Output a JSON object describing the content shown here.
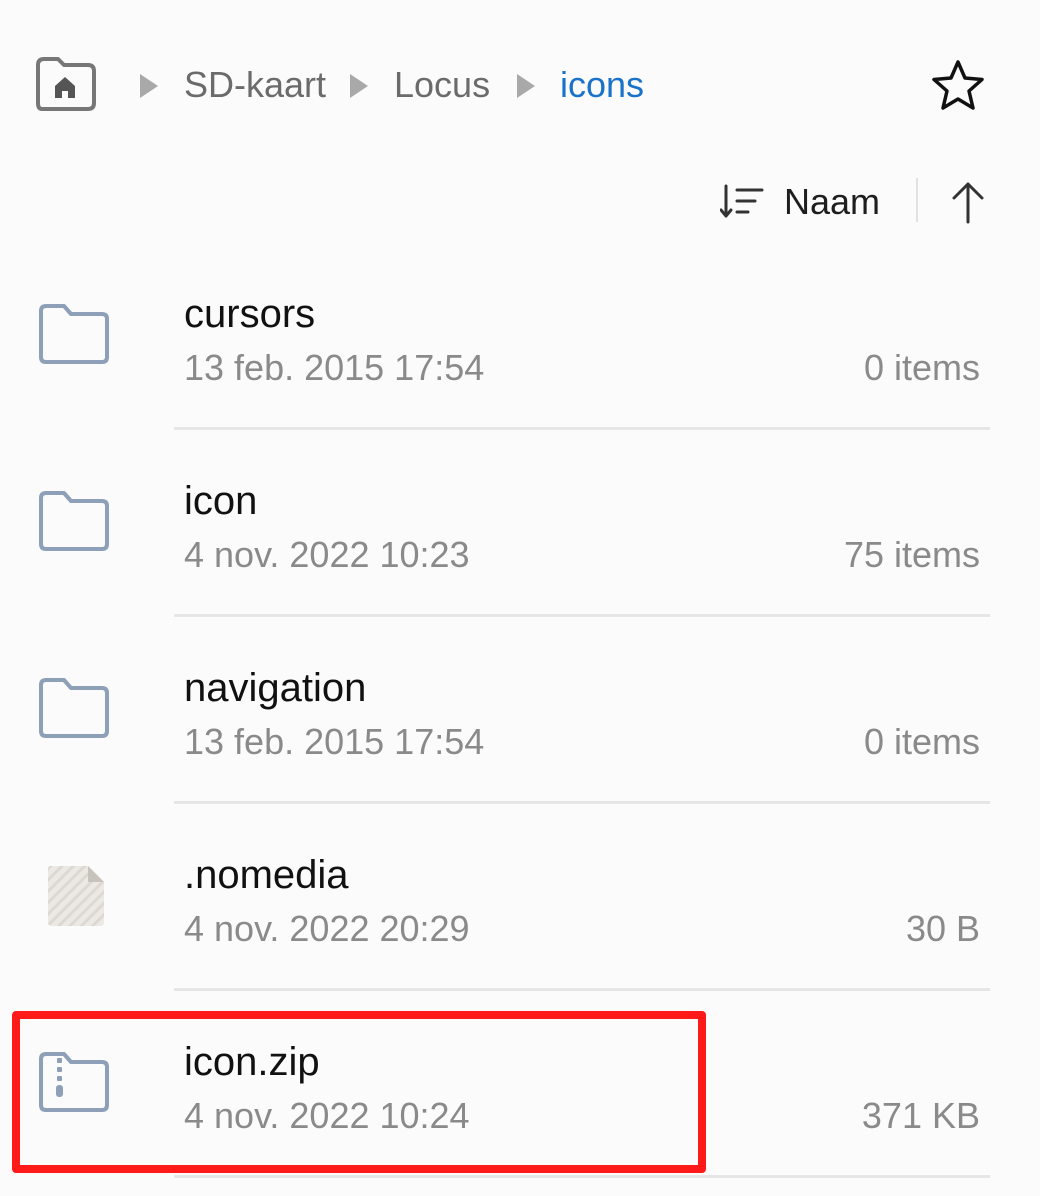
{
  "breadcrumb": {
    "home_icon": "home-folder-icon",
    "items": [
      {
        "label": "SD-kaart",
        "current": false
      },
      {
        "label": "Locus",
        "current": false
      },
      {
        "label": "icons",
        "current": true
      }
    ],
    "separator_icon": "triangle-right-icon",
    "favorite_icon": "star-outline-icon"
  },
  "sort": {
    "icon": "sort-lines-icon",
    "label": "Naam",
    "direction_icon": "arrow-up-icon"
  },
  "files": [
    {
      "name": "cursors",
      "date": "13 feb. 2015 17:54",
      "meta": "0 items",
      "type": "folder",
      "icon": "folder-icon"
    },
    {
      "name": "icon",
      "date": "4 nov. 2022 10:23",
      "meta": "75 items",
      "type": "folder",
      "icon": "folder-icon"
    },
    {
      "name": "navigation",
      "date": "13 feb. 2015 17:54",
      "meta": "0 items",
      "type": "folder",
      "icon": "folder-icon"
    },
    {
      "name": ".nomedia",
      "date": "4 nov. 2022 20:29",
      "meta": "30 B",
      "type": "file",
      "icon": "generic-file-icon"
    },
    {
      "name": "icon.zip",
      "date": "4 nov. 2022 10:24",
      "meta": "371 KB",
      "type": "zip",
      "icon": "zip-archive-icon"
    }
  ],
  "colors": {
    "accent": "#1a73c8",
    "folder_icon": "#8da0b8",
    "highlight": "#ff1a1a",
    "secondary_text": "#8a8a8a"
  }
}
